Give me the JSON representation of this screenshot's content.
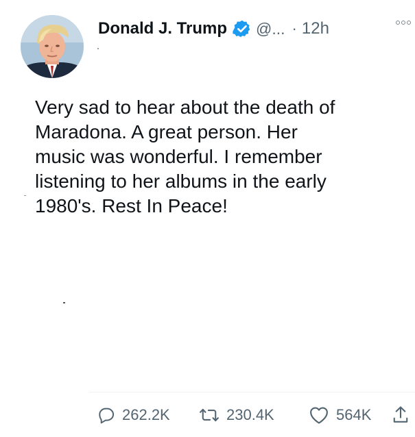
{
  "author": {
    "display_name": "Donald J. Trump",
    "handle": "@...",
    "separator": "·",
    "time_ago": "12h",
    "verified": true,
    "avatar_icon": "profile-photo"
  },
  "tweet": {
    "lines": [
      "Very sad to hear about the death of",
      "Maradona. A great person. Her",
      "music was wonderful. I remember",
      "listening to her albums in the early",
      "1980's. Rest In Peace!"
    ]
  },
  "actions": {
    "reply_count": "262.2K",
    "retweet_count": "230.4K",
    "like_count": "564K",
    "icons": [
      "reply-icon",
      "retweet-icon",
      "like-icon",
      "share-icon"
    ]
  },
  "colors": {
    "verified_blue": "#1d9bf0",
    "secondary_text": "#536471",
    "primary_text": "#0f1419"
  }
}
